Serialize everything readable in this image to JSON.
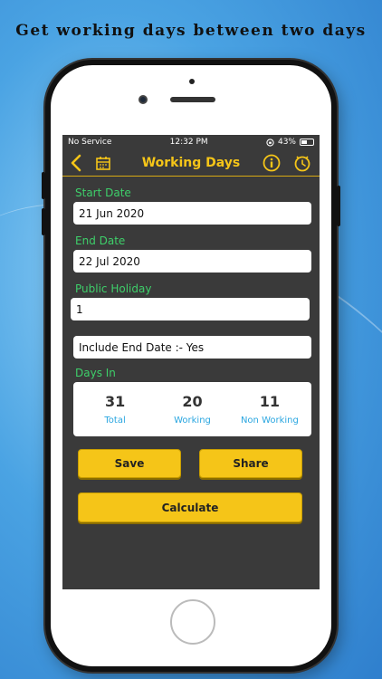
{
  "headline": "Get working days between two days",
  "status": {
    "carrier": "No Service",
    "time": "12:32 PM",
    "battery": "43%"
  },
  "nav": {
    "title": "Working Days"
  },
  "form": {
    "start_label": "Start Date",
    "start_value": "21 Jun 2020",
    "end_label": "End Date",
    "end_value": "22 Jul 2020",
    "holiday_label": "Public Holiday",
    "holiday_value": "1",
    "include_end": "Include End Date :- Yes"
  },
  "days": {
    "label": "Days In",
    "total_value": "31",
    "total_caption": "Total",
    "working_value": "20",
    "working_caption": "Working",
    "non_working_value": "11",
    "non_working_caption": "Non Working"
  },
  "buttons": {
    "save": "Save",
    "share": "Share",
    "calculate": "Calculate"
  },
  "colors": {
    "accent": "#f5c518",
    "label": "#3ecf6a",
    "caption": "#2aa6e0",
    "screen_bg": "#3a3a3a"
  }
}
